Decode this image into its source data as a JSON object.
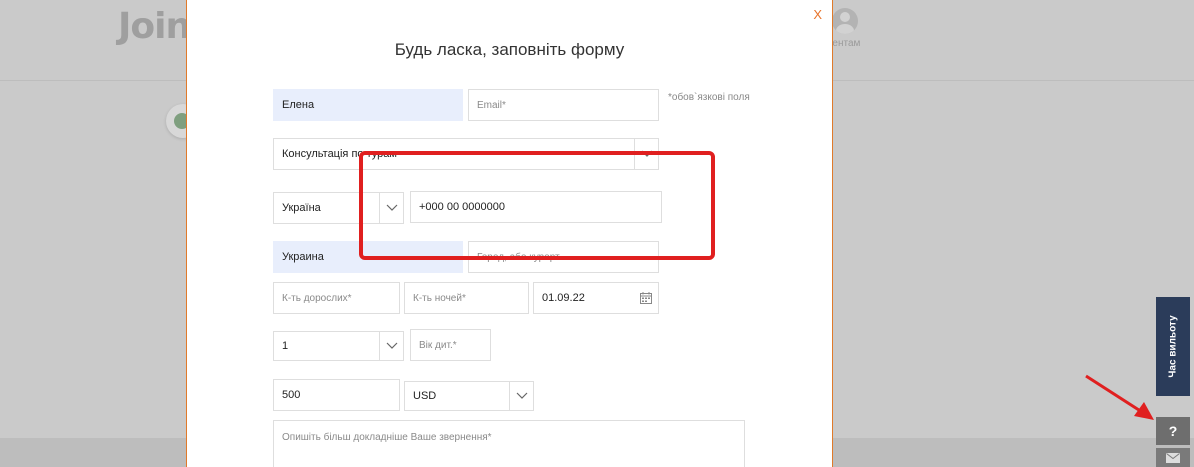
{
  "background": {
    "logo": "Join",
    "agents_label": "гентам"
  },
  "modal": {
    "close_label": "X",
    "title": "Будь ласка, заповніть форму",
    "required_note": "*обов`язкові поля",
    "fields": {
      "name_value": "Елена",
      "email_placeholder": "Email*",
      "service_value": "Консультація по турам",
      "country_code_value": "Україна",
      "phone_value": "+000 00 0000000",
      "country_value": "Украина",
      "city_placeholder": "Город, або курорт",
      "adults_placeholder": "К-ть дорослих*",
      "nights_placeholder": "К-ть ночей*",
      "date_value": "01.09.22",
      "children_value": "1",
      "child_age_placeholder": "Вік дит.*",
      "budget_value": "500",
      "currency_value": "USD",
      "message_placeholder": "Опишіть більш докладніше Ваше звернення*"
    }
  },
  "widgets": {
    "departure_time_label": "Час вильоту",
    "help_label": "?"
  },
  "colors": {
    "accent": "#e8742c",
    "highlight": "#e01f1f",
    "filled_field": "#e8eefc",
    "departure_tab": "#2b3c5a"
  }
}
